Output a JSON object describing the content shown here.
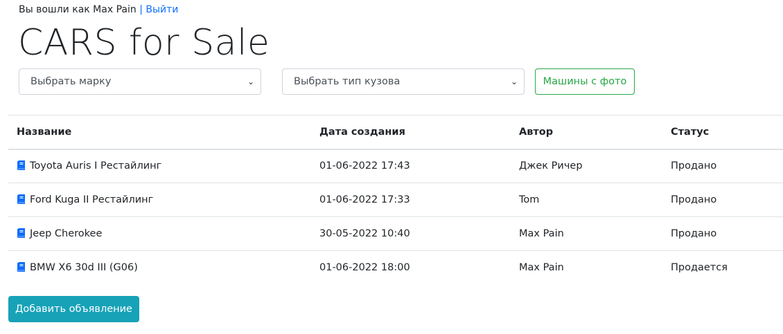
{
  "header": {
    "login_text": "Вы вошли как Max Pain",
    "separator": "|",
    "logout_link": "Выйти",
    "title": "CARS for Sale"
  },
  "filters": {
    "brand_select": "Выбрать марку",
    "body_type_select": "Выбрать тип кузова",
    "photo_button": "Машины с фото"
  },
  "table": {
    "columns": [
      "Название",
      "Дата создания",
      "Автор",
      "Статус"
    ],
    "rows": [
      {
        "name": "Toyota Auris I Рестайлинг",
        "date": "01-06-2022 17:43",
        "author": "Джек Ричер",
        "status": "Продано"
      },
      {
        "name": "Ford Kuga II Рестайлинг",
        "date": "01-06-2022 17:33",
        "author": "Tom",
        "status": "Продано"
      },
      {
        "name": "Jeep Cherokee",
        "date": "30-05-2022 10:40",
        "author": "Max Pain",
        "status": "Продано"
      },
      {
        "name": "BMW X6 30d III (G06)",
        "date": "01-06-2022 18:00",
        "author": "Max Pain",
        "status": "Продается"
      }
    ]
  },
  "actions": {
    "add_button": "Добавить объявление"
  },
  "colors": {
    "link": "#0d6efd",
    "success": "#28a745",
    "info": "#17a2b8",
    "border": "#dee2e6"
  },
  "icons": {
    "row_icon": "book-icon",
    "select_chevron": "chevron-down-icon"
  }
}
